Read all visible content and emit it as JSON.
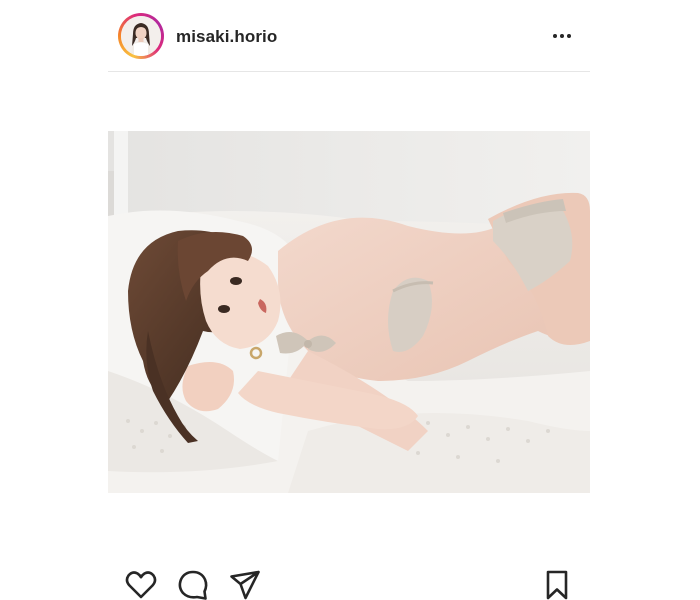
{
  "post": {
    "username": "misaki.horio",
    "avatar_icon": "profile-photo",
    "more_icon": "more-horizontal-icon",
    "photo_icon": "post-photo",
    "actions": {
      "like_icon": "heart-icon",
      "comment_icon": "comment-icon",
      "share_icon": "send-icon",
      "save_icon": "bookmark-icon"
    }
  },
  "colors": {
    "text": "#262626",
    "divider": "#e6e6e6",
    "story_ring": [
      "#f9c341",
      "#f58529",
      "#dd2a7b",
      "#b1289e"
    ]
  }
}
